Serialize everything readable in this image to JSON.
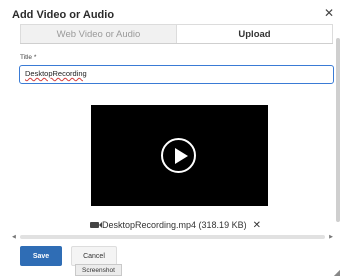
{
  "dialog": {
    "title": "Add Video or Audio",
    "close_icon": "close-icon"
  },
  "tabs": [
    {
      "label": "Web Video or Audio",
      "active": false
    },
    {
      "label": "Upload",
      "active": true
    }
  ],
  "form": {
    "title_label": "Title *",
    "title_value": "DesktopRecording"
  },
  "video": {
    "play_icon": "play-icon"
  },
  "file": {
    "icon": "video-camera-icon",
    "name_size": "DesktopRecording.mp4 (318.19 KB)",
    "remove_icon": "remove-icon"
  },
  "buttons": {
    "save_label": "Save",
    "cancel_label": "Cancel"
  },
  "tooltip": {
    "text": "Screenshot"
  },
  "colors": {
    "primary": "#2f6db5",
    "focus_border": "#3a7bd5"
  }
}
